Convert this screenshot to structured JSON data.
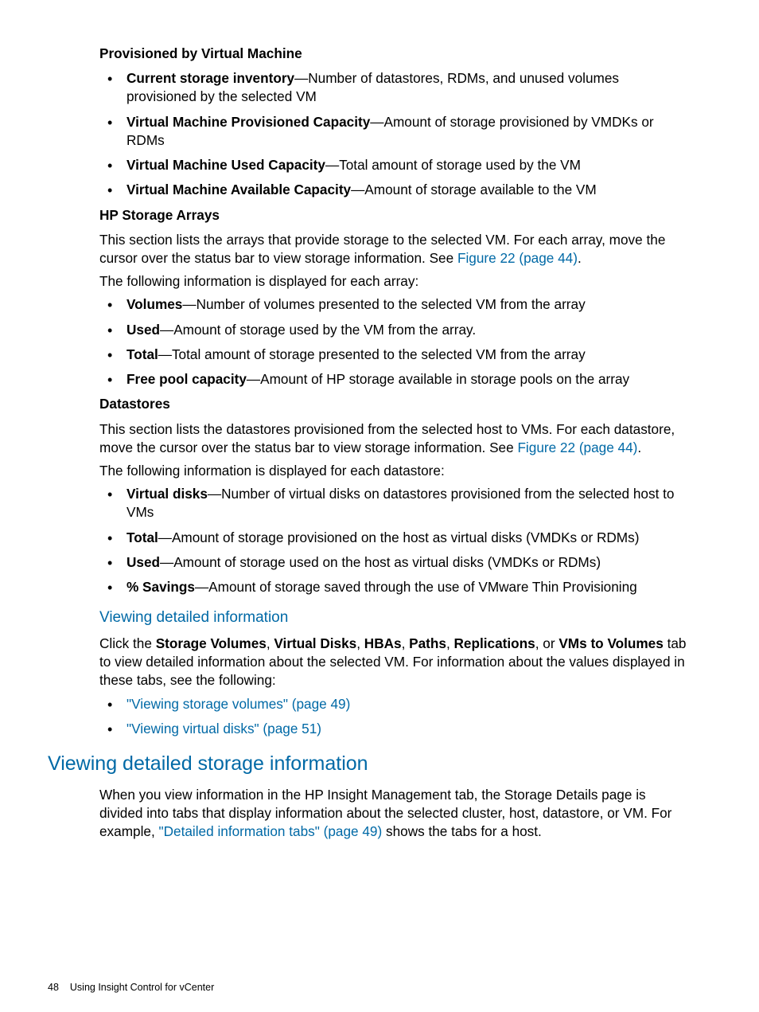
{
  "s1": {
    "heading": "Provisioned by Virtual Machine",
    "items": [
      {
        "term": "Current storage inventory",
        "desc": "—Number of datastores, RDMs, and unused volumes provisioned by the selected VM"
      },
      {
        "term": "Virtual Machine Provisioned Capacity",
        "desc": "—Amount of storage provisioned by VMDKs or RDMs"
      },
      {
        "term": "Virtual Machine Used Capacity",
        "desc": "—Total amount of storage used by the VM"
      },
      {
        "term": "Virtual Machine Available Capacity",
        "desc": "—Amount of storage available to the VM"
      }
    ]
  },
  "s2": {
    "heading": "HP Storage Arrays",
    "para1a": "This section lists the arrays that provide storage to the selected VM. For each array, move the cursor over the status bar to view storage information. See ",
    "link1": "Figure 22 (page 44)",
    "para1b": ".",
    "para2": "The following information is displayed for each array:",
    "items": [
      {
        "term": "Volumes",
        "desc": "—Number of volumes presented to the selected VM from the array"
      },
      {
        "term": "Used",
        "desc": "—Amount of storage used by the VM from the array."
      },
      {
        "term": "Total",
        "desc": "—Total amount of storage presented to the selected VM from the array"
      },
      {
        "term": "Free pool capacity",
        "desc": "—Amount of HP storage available in storage pools on the array"
      }
    ]
  },
  "s3": {
    "heading": "Datastores",
    "para1a": "This section lists the datastores provisioned from the selected host to VMs. For each datastore, move the cursor over the status bar to view storage information. See ",
    "link1": "Figure 22 (page 44)",
    "para1b": ".",
    "para2": "The following information is displayed for each datastore:",
    "items": [
      {
        "term": "Virtual disks",
        "desc": "—Number of virtual disks on datastores provisioned from the selected host to VMs"
      },
      {
        "term": "Total",
        "desc": "—Amount of storage provisioned on the host as virtual disks (VMDKs or RDMs)"
      },
      {
        "term": "Used",
        "desc": "—Amount of storage used on the host as virtual disks (VMDKs or RDMs)"
      },
      {
        "term": "% Savings",
        "desc": "—Amount of storage saved through the use of VMware Thin Provisioning"
      }
    ]
  },
  "s4": {
    "heading": "Viewing detailed information",
    "para_parts": {
      "t0": "Click the ",
      "b0": "Storage Volumes",
      "t1": ", ",
      "b1": "Virtual Disks",
      "t2": ", ",
      "b2": "HBAs",
      "t3": ", ",
      "b3": "Paths",
      "t4": ", ",
      "b4": "Replications",
      "t5": ", or ",
      "b5": "VMs to Volumes",
      "t6": " tab to view detailed information about the selected VM. For information about the values displayed in these tabs, see the following:"
    },
    "links": [
      "\"Viewing storage volumes\" (page 49)",
      "\"Viewing virtual disks\" (page 51)"
    ]
  },
  "s5": {
    "heading": "Viewing detailed storage information",
    "para_a": "When you view information in the HP Insight Management tab, the Storage Details page is divided into tabs that display information about the selected cluster, host, datastore, or VM. For example, ",
    "link": "\"Detailed information tabs\" (page 49)",
    "para_b": " shows the tabs for a host."
  },
  "footer": {
    "page": "48",
    "title": "Using Insight Control for vCenter"
  }
}
